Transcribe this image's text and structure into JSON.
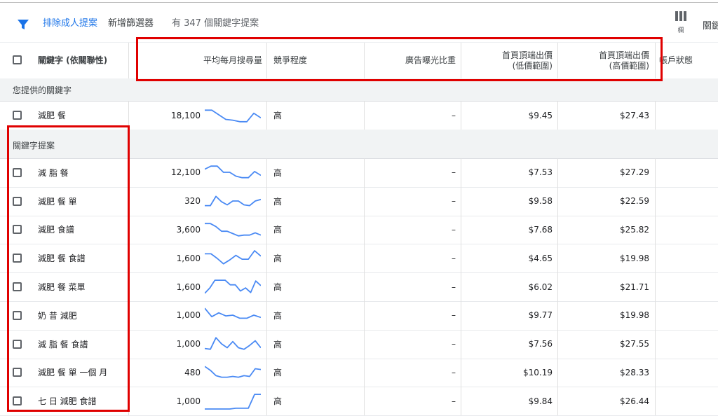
{
  "filter_bar": {
    "filter_icon": "filter-icon",
    "exclude_adult": "排除成人提案",
    "add_filter": "新增篩選器",
    "count_text": "有 347 個關鍵字提案",
    "columns_label": "欄",
    "clipped_label": "關鍵"
  },
  "columns": {
    "keyword": "關鍵字 (依關聯性)",
    "avg_monthly": "平均每月搜尋量",
    "competition": "競爭程度",
    "impression_share": "廣告曝光比重",
    "top_bid_low_l1": "首頁頂端出價",
    "top_bid_low_l2": "(低價範圍)",
    "top_bid_high_l1": "首頁頂端出價",
    "top_bid_high_l2": "(高價範圍)",
    "account_status": "帳戶狀態"
  },
  "sections": {
    "provided": "您提供的關鍵字",
    "suggestions": "關鍵字提案"
  },
  "provided_rows": [
    {
      "keyword": "減肥 餐",
      "volume": "18,100",
      "competition": "高",
      "share": "–",
      "low": "$9.45",
      "high": "$27.43",
      "trend": [
        0.15,
        0.15,
        0.45,
        0.75,
        0.8,
        0.9,
        0.9,
        0.35,
        0.65
      ]
    }
  ],
  "suggestion_rows": [
    {
      "keyword": "減 脂 餐",
      "volume": "12,100",
      "competition": "高",
      "share": "–",
      "low": "$7.53",
      "high": "$27.29",
      "trend": [
        0.3,
        0.1,
        0.1,
        0.5,
        0.5,
        0.75,
        0.85,
        0.85,
        0.45,
        0.7
      ]
    },
    {
      "keyword": "減肥 餐 單",
      "volume": "320",
      "competition": "高",
      "share": "–",
      "low": "$9.58",
      "high": "$22.59",
      "trend": [
        0.8,
        0.8,
        0.2,
        0.55,
        0.75,
        0.5,
        0.5,
        0.75,
        0.8,
        0.5,
        0.4
      ]
    },
    {
      "keyword": "減肥 食譜",
      "volume": "3,600",
      "competition": "高",
      "share": "–",
      "low": "$7.68",
      "high": "$25.82",
      "trend": [
        0.1,
        0.1,
        0.3,
        0.6,
        0.6,
        0.75,
        0.9,
        0.85,
        0.85,
        0.7,
        0.85
      ]
    },
    {
      "keyword": "減肥 餐 食譜",
      "volume": "1,600",
      "competition": "高",
      "share": "–",
      "low": "$4.65",
      "high": "$19.98",
      "trend": [
        0.2,
        0.2,
        0.5,
        0.85,
        0.6,
        0.3,
        0.55,
        0.55,
        0.0,
        0.35
      ]
    },
    {
      "keyword": "減肥 餐 菜單",
      "volume": "1,600",
      "competition": "高",
      "share": "–",
      "low": "$6.02",
      "high": "$21.71",
      "trend": [
        0.9,
        0.55,
        0.05,
        0.05,
        0.05,
        0.35,
        0.35,
        0.75,
        0.55,
        0.85,
        0.1,
        0.4
      ]
    },
    {
      "keyword": "奶 昔 減肥",
      "volume": "1,000",
      "competition": "高",
      "share": "–",
      "low": "$9.77",
      "high": "$19.98",
      "trend": [
        0.05,
        0.6,
        0.35,
        0.55,
        0.5,
        0.7,
        0.7,
        0.5,
        0.65
      ]
    },
    {
      "keyword": "減 脂 餐 食譜",
      "volume": "1,000",
      "competition": "高",
      "share": "–",
      "low": "$7.56",
      "high": "$27.55",
      "trend": [
        0.8,
        0.85,
        0.1,
        0.5,
        0.75,
        0.35,
        0.75,
        0.85,
        0.6,
        0.3,
        0.75
      ]
    },
    {
      "keyword": "減肥 餐 單 一個 月",
      "volume": "480",
      "competition": "高",
      "share": "–",
      "low": "$10.19",
      "high": "$28.33",
      "trend": [
        0.1,
        0.35,
        0.7,
        0.8,
        0.8,
        0.75,
        0.8,
        0.7,
        0.75,
        0.25,
        0.3
      ]
    },
    {
      "keyword": "七 日 減肥 食譜",
      "volume": "1,000",
      "competition": "高",
      "share": "–",
      "low": "$9.84",
      "high": "$26.44",
      "trend": [
        1.0,
        1.0,
        1.0,
        1.0,
        1.0,
        0.95,
        0.95,
        0.95,
        0.05,
        0.05
      ]
    }
  ],
  "colors": {
    "accent": "#1a73e8",
    "sparkline": "#4a8af4",
    "highlight": "#e00000"
  }
}
